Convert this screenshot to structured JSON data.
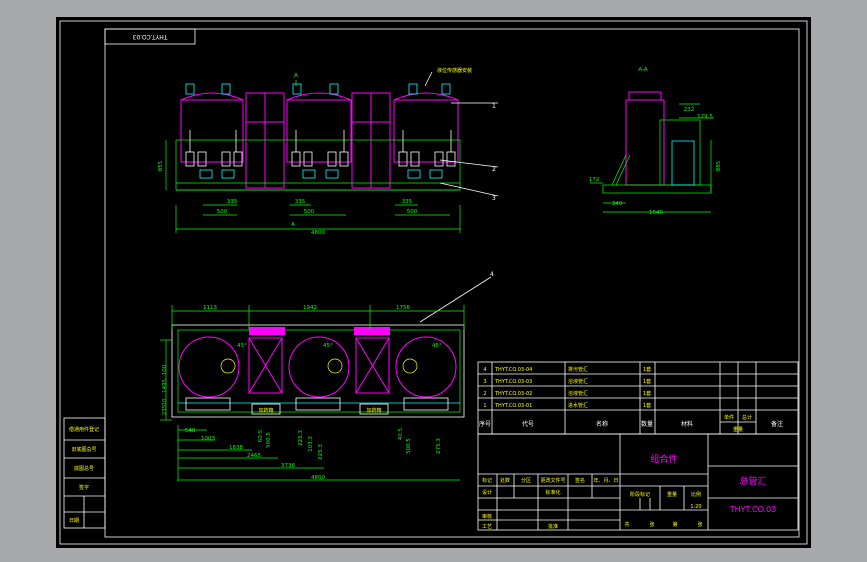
{
  "title_box": {
    "drawing_no_mirrored": "THYT.CO.03"
  },
  "front_view": {
    "label_a": "A",
    "label_b": "A",
    "note_callout": "液位传感器安装",
    "dims": {
      "d1": "335",
      "d2": "335",
      "d3": "500",
      "d4": "500",
      "d5": "500",
      "overall": "4800",
      "height_left": "855"
    }
  },
  "side_view": {
    "section_label": "A-A",
    "dims": {
      "top": "232",
      "offset": "129.5",
      "left": "172",
      "bottom_left": "340",
      "bottom": "1640",
      "height": "885"
    }
  },
  "plan_view": {
    "top_dims": [
      "1113",
      "1942",
      "1756"
    ],
    "left_dims": [
      "1495",
      "10",
      "235",
      "100"
    ],
    "bottom_dims": [
      "540",
      "1003",
      "1838",
      "2465",
      "3736",
      "4800"
    ],
    "vertical_dims": [
      "60.5",
      "500.5",
      "225.3",
      "103.3",
      "225.3",
      "40.5",
      "500.5",
      "275.3"
    ],
    "angles": [
      "45°",
      "45°",
      "45°"
    ],
    "module_labels": [
      "加药箱",
      "加药箱"
    ]
  },
  "callouts": [
    "1",
    "2",
    "3",
    "4"
  ],
  "bom": {
    "rows": [
      {
        "no": "4",
        "code": "THYT.CO.03-04",
        "name": "排污管汇",
        "qty": "1套"
      },
      {
        "no": "3",
        "code": "THYT.CO.03-03",
        "name": "溶液管汇",
        "qty": "1套"
      },
      {
        "no": "2",
        "code": "THYT.CO.03-02",
        "name": "溶液管汇",
        "qty": "1套"
      },
      {
        "no": "1",
        "code": "THYT.CO.03-01",
        "name": "进水管汇",
        "qty": "1套"
      }
    ],
    "headers": {
      "no": "序号",
      "code": "代号",
      "name": "名称",
      "qty": "数量",
      "material": "材料",
      "unit": "单件",
      "total": "总计",
      "weight": "重量",
      "remark": "备注"
    }
  },
  "title_block": {
    "assembly": "组合件",
    "drawing_name": "总管汇",
    "drawing_no": "THYT.CO.03",
    "scale": "1:20",
    "labels": {
      "mark": "标记",
      "count": "处数",
      "zone": "分区",
      "change_doc": "更改文件号",
      "sign": "签名",
      "date": "年、月、日",
      "design": "设计",
      "standard": "标准化",
      "stage_mark": "阶段标记",
      "weight": "重量",
      "ratio": "比例",
      "review": "审核",
      "process": "工艺",
      "approve": "批准",
      "sheets": "共",
      "zhang": "张",
      "page": "第",
      "zhang2": "张"
    }
  },
  "side_strip": [
    "借通用件登记",
    "旧底图总号",
    "底图总号",
    "签字",
    "日期"
  ]
}
